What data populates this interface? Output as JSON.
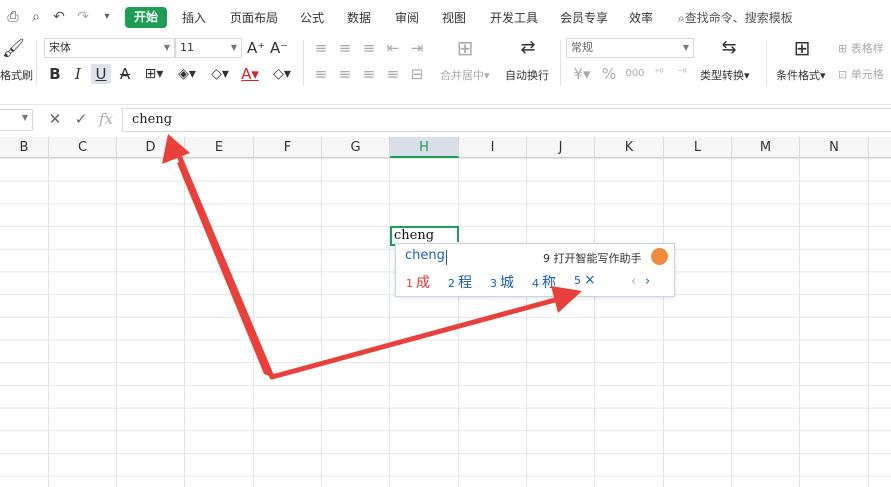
{
  "menu": {
    "tabs": [
      "开始",
      "插入",
      "页面布局",
      "公式",
      "数据",
      "审阅",
      "视图",
      "开发工具",
      "会员专享",
      "效率"
    ],
    "active_tab": "开始",
    "search_label": "查找命令、搜索模板"
  },
  "ribbon": {
    "format_painter_label": "格式刷",
    "font_name": "宋体",
    "font_size": "11",
    "bold": "B",
    "italic": "I",
    "underline": "U",
    "merge_label": "合并居中",
    "wrap_label": "自动换行",
    "number_format": "常规",
    "percent": "%",
    "thousands": "000",
    "type_convert_label": "类型转换",
    "cond_format_label": "条件格式",
    "table_style_label": "表格样",
    "cell_style_label": "单元格"
  },
  "formula_bar": {
    "fx": "fx",
    "content": "cheng"
  },
  "columns": [
    "B",
    "C",
    "D",
    "E",
    "F",
    "G",
    "H",
    "I",
    "J",
    "K",
    "L",
    "M",
    "N"
  ],
  "selected_column": "H",
  "active_cell": {
    "value": "cheng"
  },
  "ime": {
    "input": "cheng",
    "assist": "9 打开智能写作助手",
    "candidates": [
      {
        "num": "1",
        "text": "成"
      },
      {
        "num": "2",
        "text": "程"
      },
      {
        "num": "3",
        "text": "城"
      },
      {
        "num": "4",
        "text": "称"
      },
      {
        "num": "5",
        "text": "×"
      }
    ],
    "prev": "‹",
    "next": "›"
  },
  "colors": {
    "accent": "#1f9d55",
    "annotation_arrow": "#e8413b",
    "ime_blue": "#1a5dbd"
  }
}
